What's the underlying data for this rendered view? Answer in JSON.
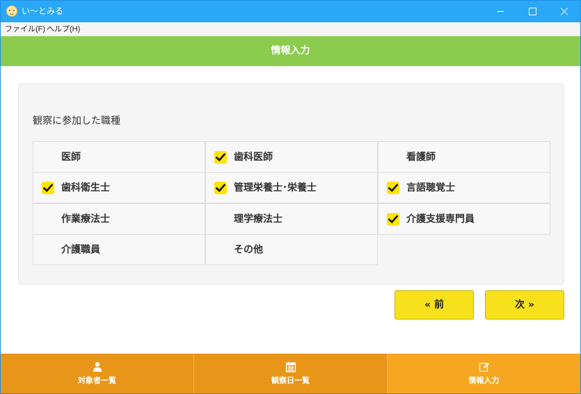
{
  "window": {
    "title": "い〜とみる"
  },
  "menu": {
    "file": "ファイル(F)",
    "help": "ヘルプ(H)"
  },
  "header": {
    "title": "情報入力"
  },
  "section": {
    "title": "観察に参加した職種"
  },
  "occupations": [
    {
      "label": "医師",
      "checked": false
    },
    {
      "label": "歯科医師",
      "checked": true
    },
    {
      "label": "看護師",
      "checked": false
    },
    {
      "label": "歯科衛生士",
      "checked": true
    },
    {
      "label": "管理栄養士･栄養士",
      "checked": true
    },
    {
      "label": "言語聴覚士",
      "checked": true
    },
    {
      "label": "作業療法士",
      "checked": false
    },
    {
      "label": "理学療法士",
      "checked": false
    },
    {
      "label": "介護支援専門員",
      "checked": true
    },
    {
      "label": "介護職員",
      "checked": false
    },
    {
      "label": "その他",
      "checked": false
    }
  ],
  "nav": {
    "prev": "« 前",
    "next": "次 »"
  },
  "tabs": [
    {
      "label": "対象者一覧",
      "icon": "user-icon",
      "active": false
    },
    {
      "label": "観察日一覧",
      "icon": "calendar-icon",
      "active": false
    },
    {
      "label": "情報入力",
      "icon": "edit-icon",
      "active": true
    }
  ],
  "colors": {
    "titlebar": "#2aa7f7",
    "header": "#8bcc4f",
    "checkbox": "#ffe400",
    "button": "#f7e11c",
    "tab": "#e7961a",
    "tab_active": "#f7a622"
  }
}
